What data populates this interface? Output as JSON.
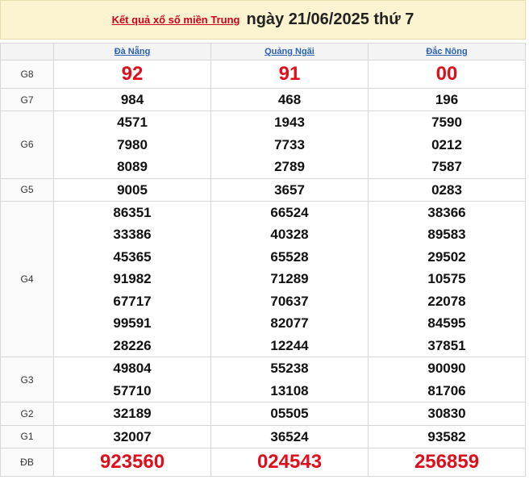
{
  "header": {
    "link_text": "Kết quả xổ số miền Trung",
    "date_text": "ngày 21/06/2025 thứ 7"
  },
  "provinces": [
    "Đà Nẵng",
    "Quảng Ngãi",
    "Đắc Nông"
  ],
  "prizes": [
    {
      "label": "G8",
      "cols": [
        [
          "92"
        ],
        [
          "91"
        ],
        [
          "00"
        ]
      ]
    },
    {
      "label": "G7",
      "cols": [
        [
          "984"
        ],
        [
          "468"
        ],
        [
          "196"
        ]
      ]
    },
    {
      "label": "G6",
      "cols": [
        [
          "4571",
          "7980",
          "8089"
        ],
        [
          "1943",
          "7733",
          "2789"
        ],
        [
          "7590",
          "0212",
          "7587"
        ]
      ]
    },
    {
      "label": "G5",
      "cols": [
        [
          "9005"
        ],
        [
          "3657"
        ],
        [
          "0283"
        ]
      ]
    },
    {
      "label": "G4",
      "cols": [
        [
          "86351",
          "33386",
          "45365",
          "91982",
          "67717",
          "99591",
          "28226"
        ],
        [
          "66524",
          "40328",
          "65528",
          "71289",
          "70637",
          "82077",
          "12244"
        ],
        [
          "38366",
          "89583",
          "29502",
          "10575",
          "22078",
          "84595",
          "37851"
        ]
      ]
    },
    {
      "label": "G3",
      "cols": [
        [
          "49804",
          "57710"
        ],
        [
          "55238",
          "13108"
        ],
        [
          "90090",
          "81706"
        ]
      ]
    },
    {
      "label": "G2",
      "cols": [
        [
          "32189"
        ],
        [
          "05505"
        ],
        [
          "30830"
        ]
      ]
    },
    {
      "label": "G1",
      "cols": [
        [
          "32007"
        ],
        [
          "36524"
        ],
        [
          "93582"
        ]
      ]
    },
    {
      "label": "ĐB",
      "cols": [
        [
          "923560"
        ],
        [
          "024543"
        ],
        [
          "256859"
        ]
      ]
    }
  ],
  "colors": {
    "accent_red": "#e00d1b",
    "header_bg": "#fcf4d0",
    "link_blue": "#2a62b8"
  }
}
